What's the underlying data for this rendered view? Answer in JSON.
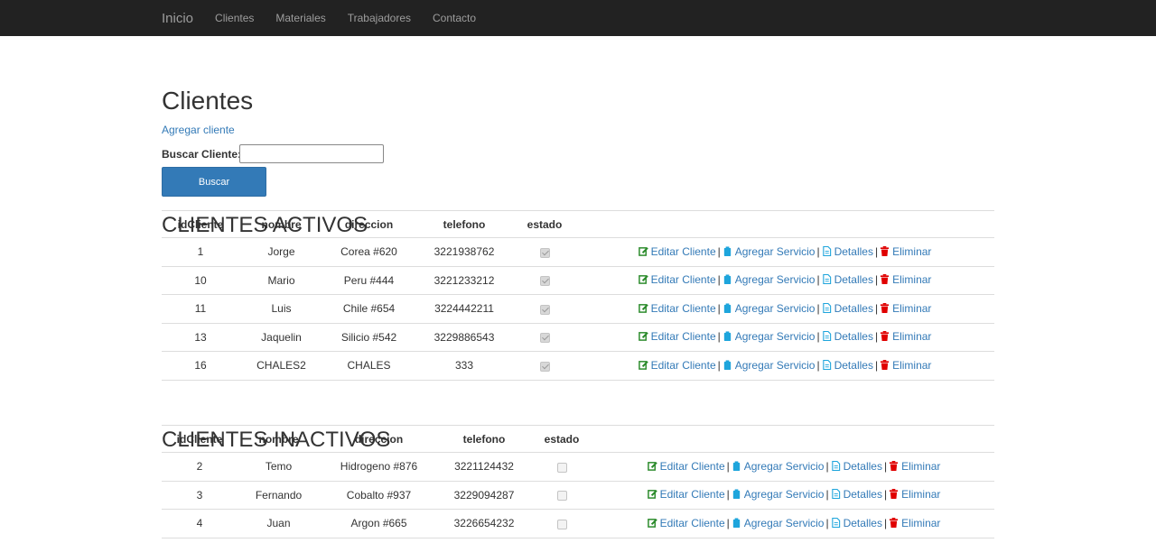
{
  "nav": {
    "brand": "Inicio",
    "items": [
      "Clientes",
      "Materiales",
      "Trabajadores",
      "Contacto"
    ]
  },
  "page": {
    "title": "Clientes",
    "add_link": "Agregar cliente",
    "search_label": "Buscar Cliente:",
    "search_value": "",
    "search_button": "Buscar"
  },
  "actions": {
    "edit": "Editar Cliente",
    "add_service": "Agregar Servicio",
    "details": "Detalles",
    "delete": "Eliminar",
    "separator": "|"
  },
  "columns": [
    "idCliente",
    "nombre",
    "direccion",
    "telefono",
    "estado"
  ],
  "active": {
    "title": "CLIENTES ACTIVOS",
    "rows": [
      {
        "id": "1",
        "nombre": "Jorge",
        "direccion": "Corea #620",
        "telefono": "3221938762",
        "estado": true
      },
      {
        "id": "10",
        "nombre": "Mario",
        "direccion": "Peru #444",
        "telefono": "3221233212",
        "estado": true
      },
      {
        "id": "11",
        "nombre": "Luis",
        "direccion": "Chile #654",
        "telefono": "3224442211",
        "estado": true
      },
      {
        "id": "13",
        "nombre": "Jaquelin",
        "direccion": "Silicio #542",
        "telefono": "3229886543",
        "estado": true
      },
      {
        "id": "16",
        "nombre": "CHALES2",
        "direccion": "CHALES",
        "telefono": "333",
        "estado": true
      }
    ]
  },
  "inactive": {
    "title": "CLIENTES INACTIVOS",
    "rows": [
      {
        "id": "2",
        "nombre": "Temo",
        "direccion": "Hidrogeno #876",
        "telefono": "3221124432",
        "estado": false
      },
      {
        "id": "3",
        "nombre": "Fernando",
        "direccion": "Cobalto #937",
        "telefono": "3229094287",
        "estado": false
      },
      {
        "id": "4",
        "nombre": "Juan",
        "direccion": "Argon #665",
        "telefono": "3226654232",
        "estado": false
      }
    ]
  },
  "colors": {
    "navbar": "#222222",
    "link": "#337ab7",
    "edit_icon": "#2a8a2a",
    "service_icon": "#1ea5dc",
    "delete_icon": "#e00000"
  },
  "icons": {
    "edit": "edit-icon",
    "service": "clipboard-icon",
    "details": "file-icon",
    "delete": "trash-icon"
  }
}
